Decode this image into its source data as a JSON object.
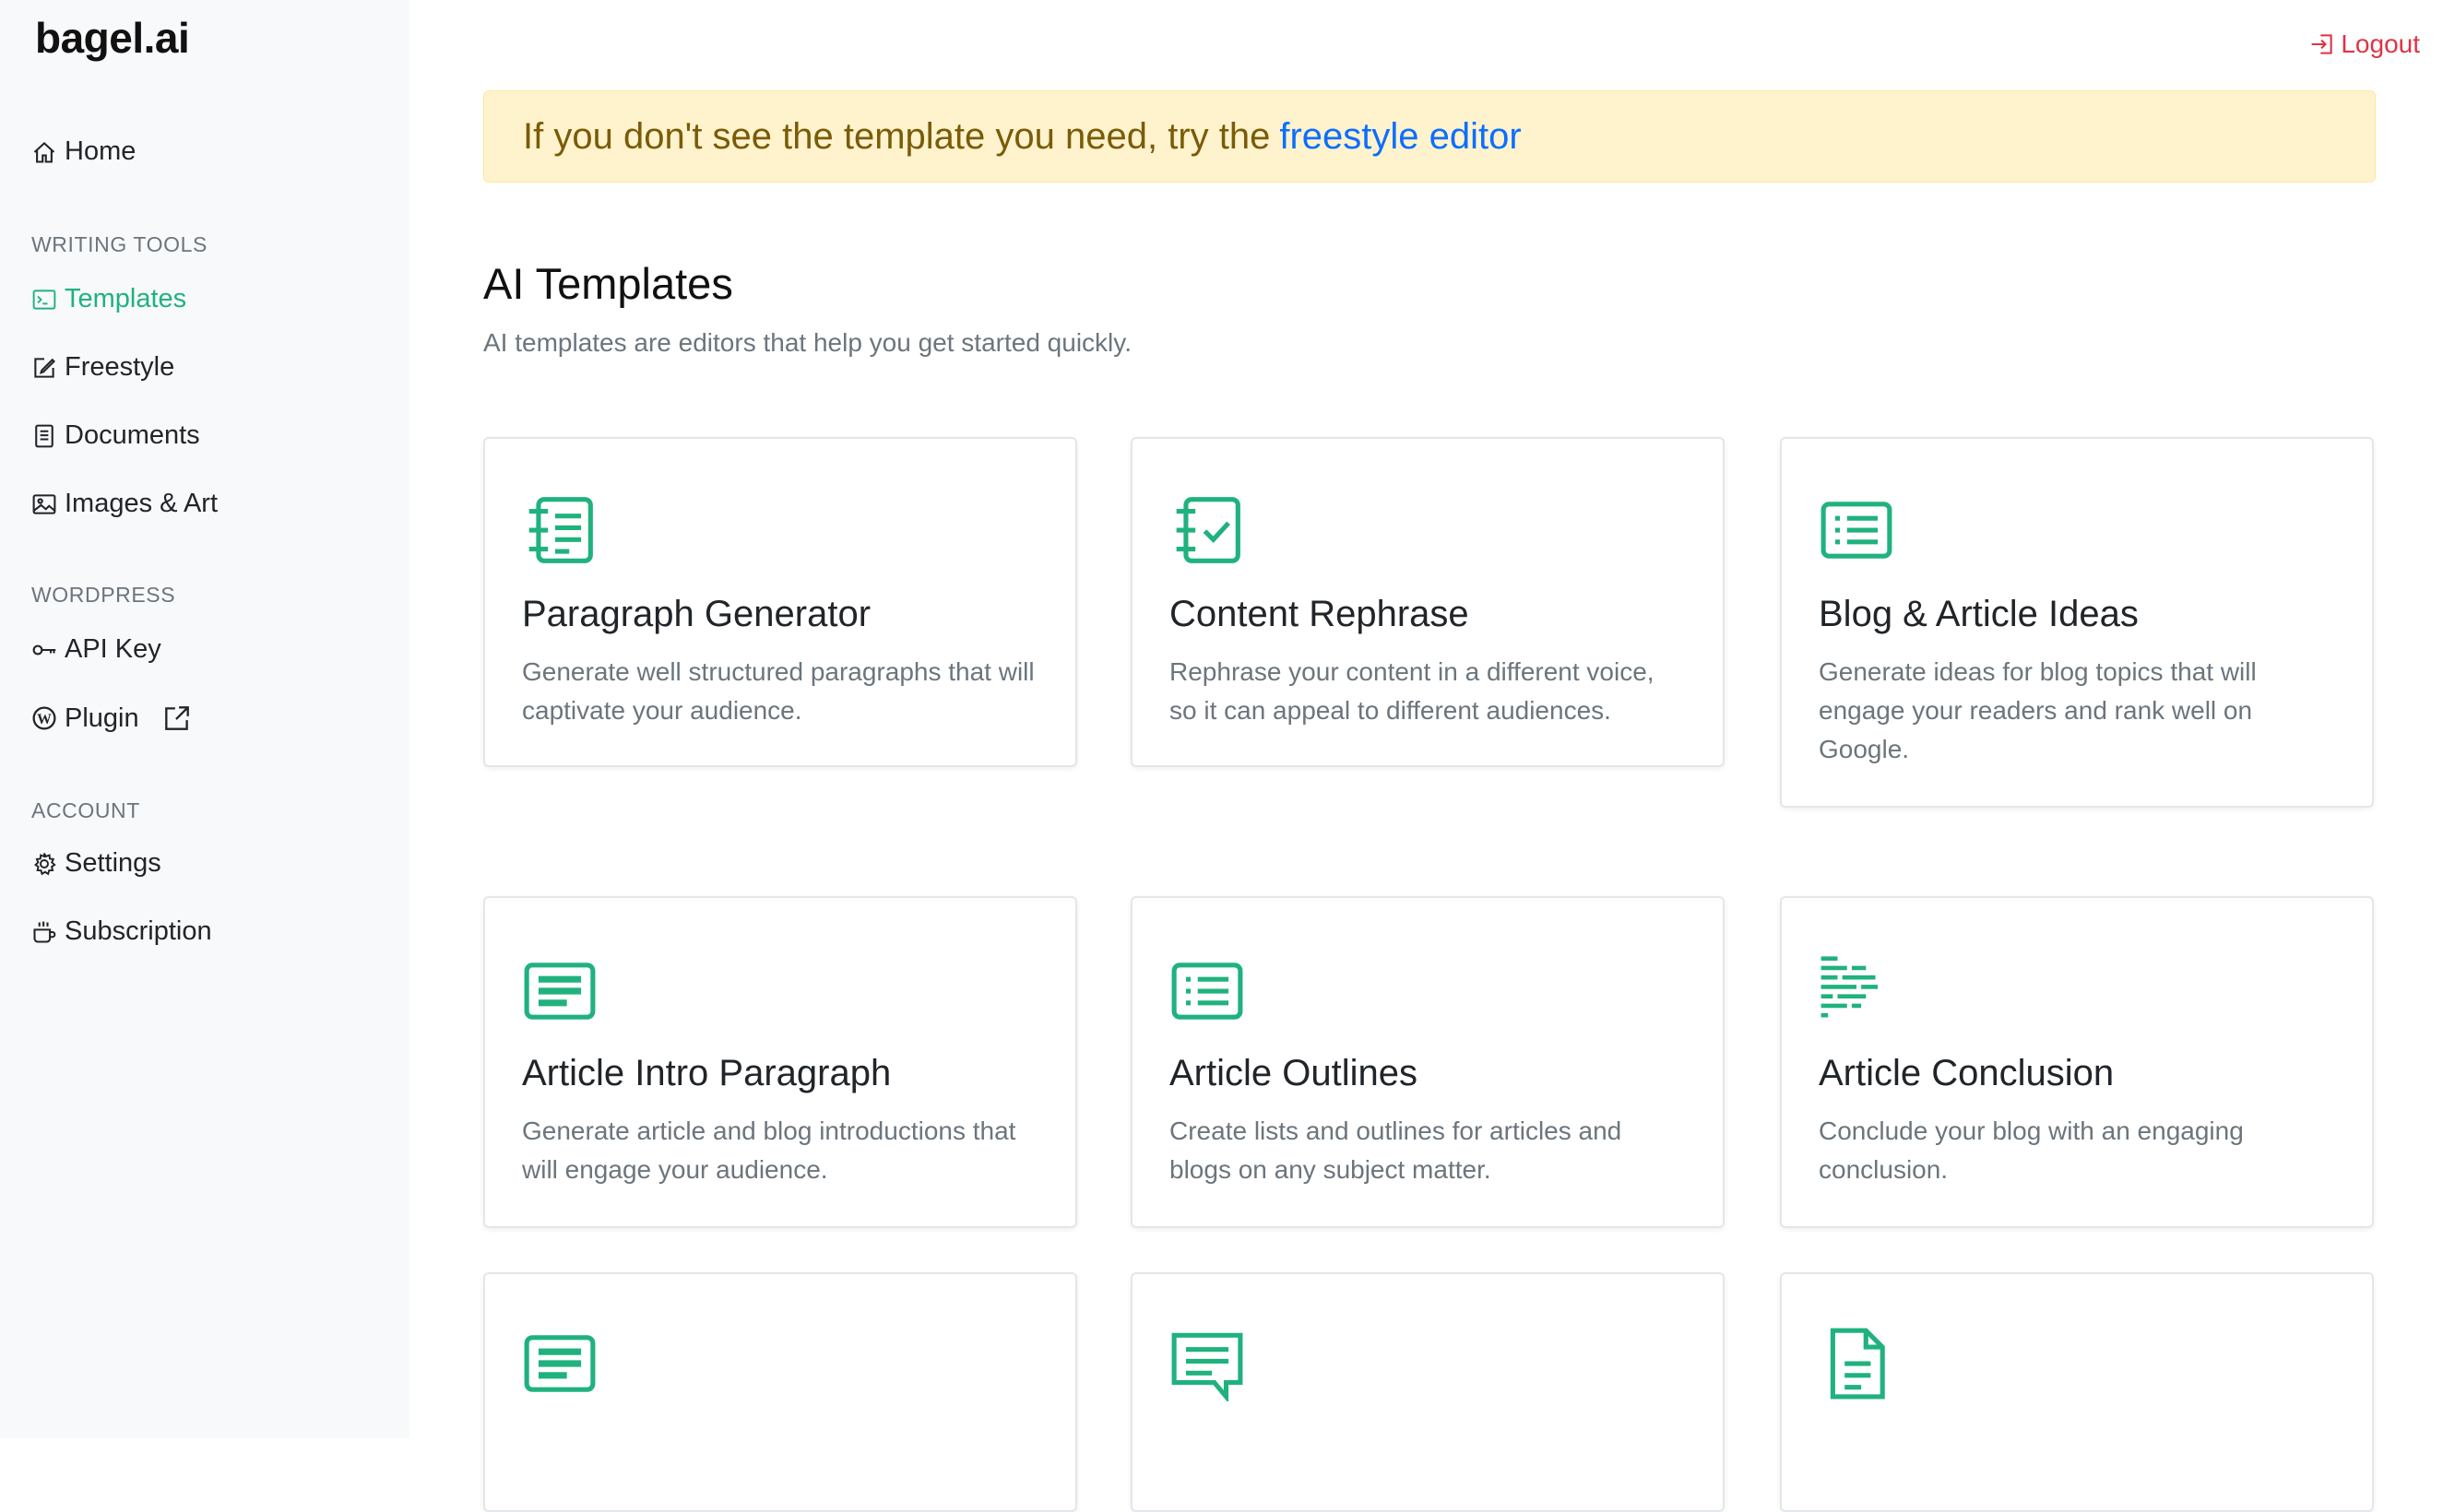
{
  "brand": "bagel.ai",
  "nav": {
    "home": "Home",
    "writing_tools_label": "WRITING TOOLS",
    "templates": "Templates",
    "freestyle": "Freestyle",
    "documents": "Documents",
    "images_art": "Images & Art",
    "wordpress_label": "WORDPRESS",
    "api_key": "API Key",
    "plugin": "Plugin",
    "account_label": "ACCOUNT",
    "settings": "Settings",
    "subscription": "Subscription"
  },
  "header": {
    "logout": "Logout"
  },
  "banner": {
    "text": "If you don't see the template you need, try the",
    "link": "freestyle editor"
  },
  "main": {
    "title": "AI Templates",
    "subtitle": "AI templates are editors that help you get started quickly."
  },
  "cards": [
    {
      "title": "Paragraph Generator",
      "desc": "Generate well structured paragraphs that will captivate your audience.",
      "icon": "notebook-list-icon"
    },
    {
      "title": "Content Rephrase",
      "desc": "Rephrase your content in a different voice, so it can appeal to different audiences.",
      "icon": "notebook-check-icon"
    },
    {
      "title": "Blog & Article Ideas",
      "desc": "Generate ideas for blog topics that will engage your readers and rank well on Google.",
      "icon": "list-box-icon"
    },
    {
      "title": "Article Intro Paragraph",
      "desc": "Generate article and blog introductions that will engage your audience.",
      "icon": "card-text-icon"
    },
    {
      "title": "Article Outlines",
      "desc": "Create lists and outlines for articles and blogs on any subject matter.",
      "icon": "list-box-icon"
    },
    {
      "title": "Article Conclusion",
      "desc": "Conclude your blog with an engaging conclusion.",
      "icon": "text-paragraph-icon"
    },
    {
      "title": "",
      "desc": "",
      "icon": "card-text-icon"
    },
    {
      "title": "",
      "desc": "",
      "icon": "chat-text-icon"
    },
    {
      "title": "",
      "desc": "",
      "icon": "file-text-icon"
    }
  ],
  "colors": {
    "accent": "#20b27e",
    "logout": "#dc3545",
    "link": "#0d6efd",
    "banner_bg": "#fff3cd",
    "banner_text": "#7a5b08"
  }
}
